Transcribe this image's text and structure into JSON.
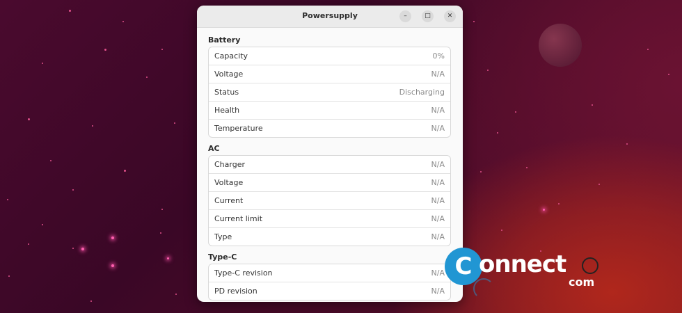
{
  "window": {
    "title": "Powersupply",
    "buttons": {
      "minimize": "–",
      "maximize": "□",
      "close": "✕"
    }
  },
  "sections": [
    {
      "title": "Battery",
      "rows": [
        {
          "label": "Capacity",
          "value": "0%"
        },
        {
          "label": "Voltage",
          "value": "N/A"
        },
        {
          "label": "Status",
          "value": "Discharging"
        },
        {
          "label": "Health",
          "value": "N/A"
        },
        {
          "label": "Temperature",
          "value": "N/A"
        }
      ]
    },
    {
      "title": "AC",
      "rows": [
        {
          "label": "Charger",
          "value": "N/A"
        },
        {
          "label": "Voltage",
          "value": "N/A"
        },
        {
          "label": "Current",
          "value": "N/A"
        },
        {
          "label": "Current limit",
          "value": "N/A"
        },
        {
          "label": "Type",
          "value": "N/A"
        }
      ]
    },
    {
      "title": "Type-C",
      "rows": [
        {
          "label": "Type-C revision",
          "value": "N/A"
        },
        {
          "label": "PD revision",
          "value": "N/A"
        }
      ]
    }
  ],
  "watermark": {
    "letter": "C",
    "text": "onnect",
    "suffix": "com"
  },
  "colors": {
    "accent": "#2196d3",
    "window_bg": "#fafafa",
    "titlebar_bg": "#ebebeb"
  }
}
